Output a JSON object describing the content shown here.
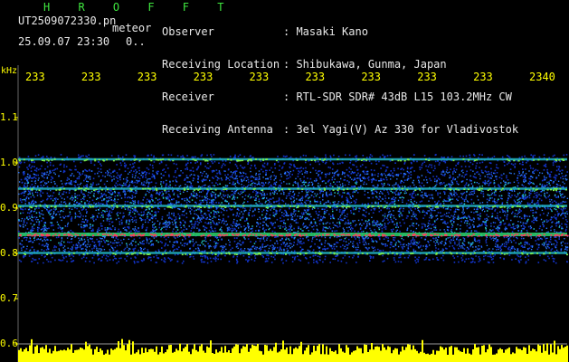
{
  "header": {
    "logo": "H R O F F T",
    "filename": "UT2509072330.pn",
    "tag": "meteor",
    "date": "25.09.07 23:30",
    "extra": "0..",
    "rows": [
      {
        "label": "Observer",
        "value": ": Masaki Kano"
      },
      {
        "label": "Receiving Location",
        "value": ": Shibukawa, Gunma, Japan"
      },
      {
        "label": "Receiver",
        "value": ": RTL-SDR SDR# 43dB L15 103.2MHz CW"
      },
      {
        "label": "Receiving Antenna",
        "value": ": 3el Yagi(V) Az 330 for Vladivostok"
      }
    ]
  },
  "colors": {
    "background": "#000000",
    "header_green": "#3fe63f",
    "axis_yellow": "#ffff00",
    "gridline": "#9a9a9a"
  },
  "chart_data": {
    "type": "heatmap",
    "title": "",
    "ylabel": "kHz",
    "x_tick_labels": [
      "233",
      "233",
      "233",
      "233",
      "233",
      "233",
      "233",
      "233",
      "233",
      "2340"
    ],
    "y_ticks": [
      0.6,
      0.7,
      0.8,
      0.9,
      1.0,
      1.1
    ],
    "y_tick_labels": [
      "0.6",
      "0.7",
      "0.8",
      "0.9",
      "1.0",
      "1.1"
    ],
    "ylim": [
      0.6,
      1.2
    ],
    "signal_lines_khz": [
      0.801,
      0.842,
      0.905,
      0.943,
      1.008
    ],
    "strongest_line_khz": 0.842,
    "noise_band_khz": [
      0.78,
      1.02
    ],
    "power_trace": "yellow bar graph along bottom"
  }
}
